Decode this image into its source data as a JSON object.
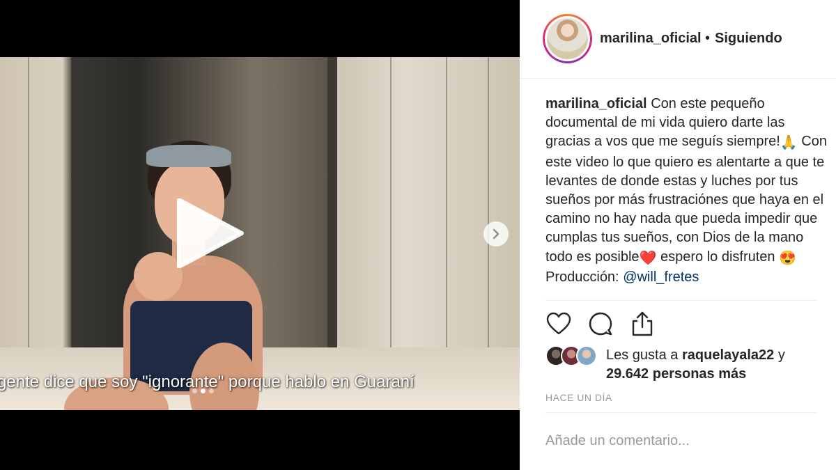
{
  "post": {
    "username": "marilina_oficial",
    "separator": "•",
    "follow_status": "Siguiendo"
  },
  "media": {
    "subtitle": "gente dice que soy \"ignorante\" porque hablo en Guaraní",
    "carousel": {
      "count": 3,
      "active_index": 1
    },
    "play_icon": "play-icon",
    "next_icon": "chevron-right-icon"
  },
  "caption": {
    "username": "marilina_oficial",
    "text_1": "Con este pequeño documental de mi vida quiero darte las gracias a vos que me seguís siempre!",
    "emoji_1": "🙏",
    "text_2": "Con este video lo que quiero es alentarte a que te levantes de donde estas y luches por tus sueños por más frustraciónes que haya en el camino no hay nada que pueda impedir que cumplas tus sueños, con Dios de la mano todo es posible",
    "emoji_2": "❤️",
    "text_3": "espero lo disfruten",
    "emoji_3": "😍",
    "production_label": "Producción:",
    "production_mention": "@will_fretes"
  },
  "actions": {
    "like_icon": "heart-icon",
    "comment_icon": "comment-icon",
    "share_icon": "share-icon"
  },
  "likes": {
    "prefix": "Les gusta a",
    "user": "raquelayala22",
    "conjunction": "y",
    "others": "29.642 personas más"
  },
  "timestamp": "HACE UN DÍA",
  "comment_input": {
    "placeholder": "Añade un comentario..."
  },
  "colors": {
    "text": "#262626",
    "muted": "#999999",
    "mention": "#003569",
    "ring_start": "#f58529",
    "ring_mid": "#dd2a7b"
  }
}
